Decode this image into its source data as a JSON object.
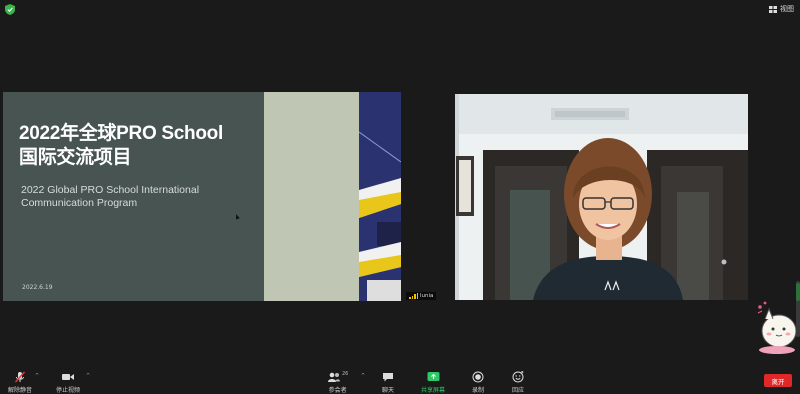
{
  "top_bar": {
    "view_label": "视图",
    "security_icon": "shield-icon",
    "security_color": "#3bb44a"
  },
  "slide": {
    "title_line1": "2022年全球PRO School",
    "title_line2": "国际交流项目",
    "subtitle_line1": "2022 Global PRO School International",
    "subtitle_line2": "Communication Program",
    "date": "2022.6.19",
    "background_color": "#485452"
  },
  "presenter": {
    "name": "lunia"
  },
  "toolbar": {
    "mute": {
      "label": "解除静音",
      "icon": "muted-microphone-icon"
    },
    "video": {
      "label": "停止视频",
      "icon": "video-camera-icon"
    },
    "participants": {
      "label": "参会者",
      "icon": "participants-icon",
      "count": "26"
    },
    "chat": {
      "label": "聊天",
      "icon": "chat-bubble-icon"
    },
    "share": {
      "label": "共享屏幕",
      "icon": "share-screen-icon",
      "color": "#2ec866"
    },
    "record": {
      "label": "录制",
      "icon": "record-icon"
    },
    "reactions": {
      "label": "回应",
      "icon": "emoji-icon"
    },
    "leave": {
      "label": "离开",
      "color": "#e02828"
    }
  }
}
